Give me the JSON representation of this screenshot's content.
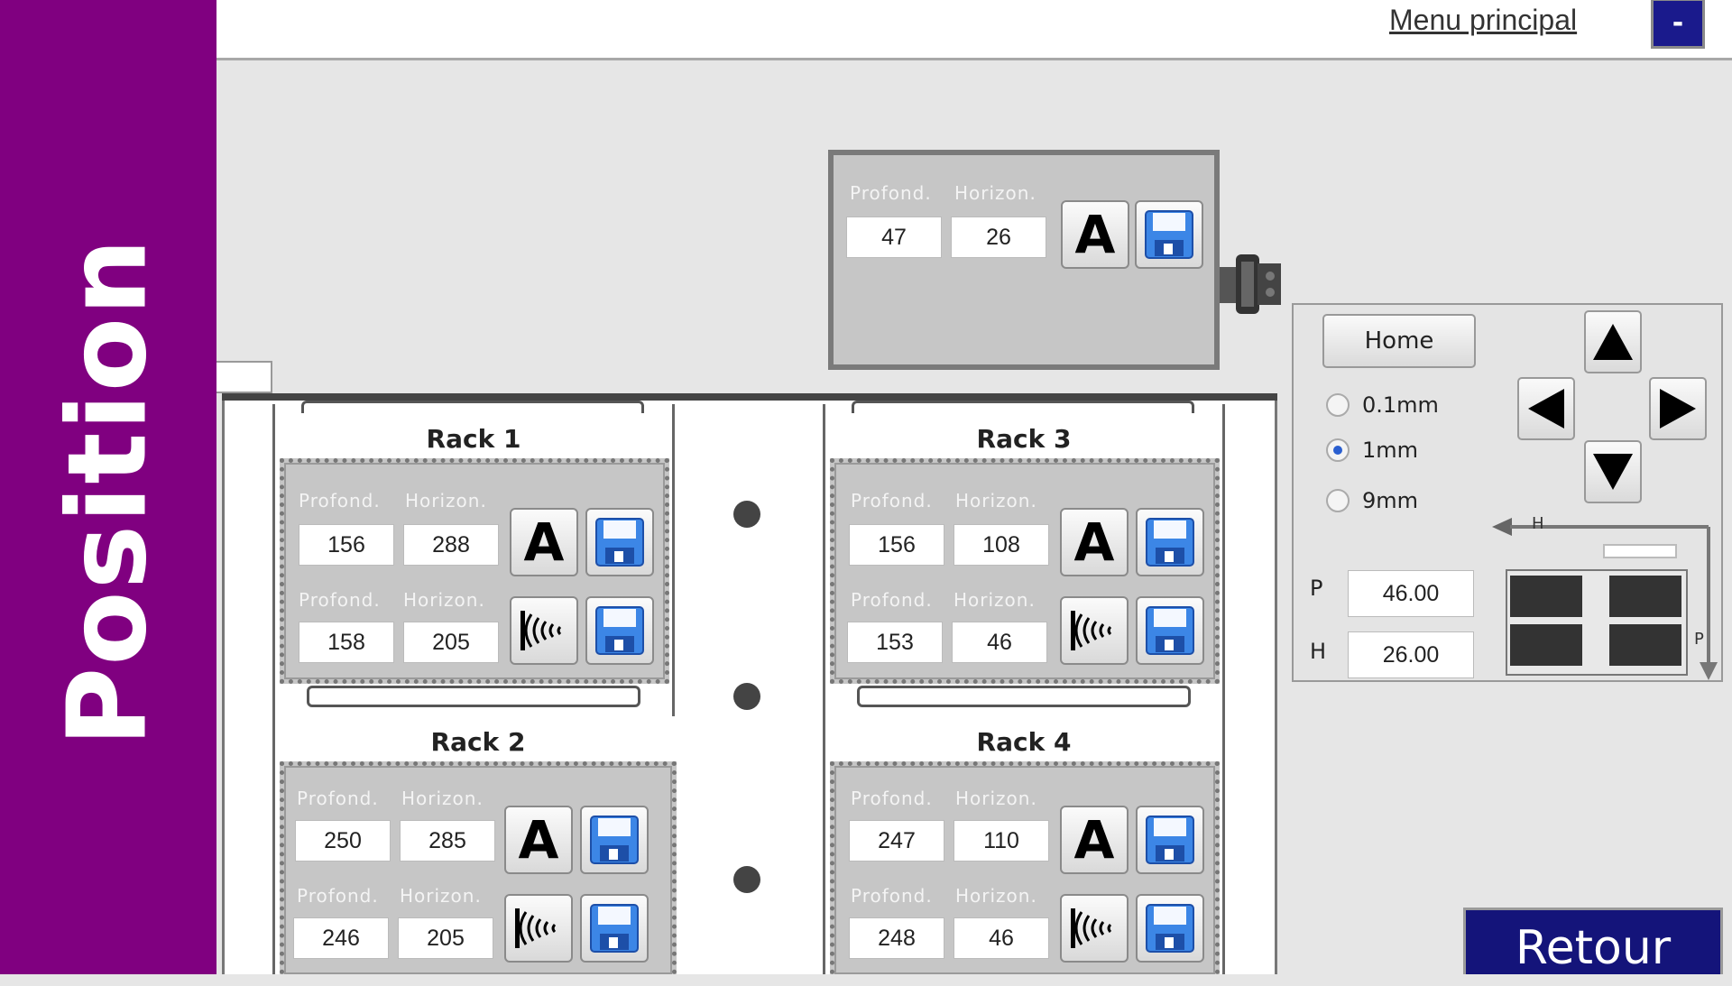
{
  "sidebar": {
    "title": "Position"
  },
  "topbar": {
    "menu_label": "Menu principal",
    "minimize_label": "-"
  },
  "labels": {
    "profond": "Profond.",
    "horizon": "Horizon."
  },
  "top_panel": {
    "profond": "47",
    "horizon": "26"
  },
  "racks": [
    {
      "title": "Rack 1",
      "row1": {
        "profond": "156",
        "horizon": "288"
      },
      "row2": {
        "profond": "158",
        "horizon": "205"
      }
    },
    {
      "title": "Rack 2",
      "row1": {
        "profond": "250",
        "horizon": "285"
      },
      "row2": {
        "profond": "246",
        "horizon": "205"
      }
    },
    {
      "title": "Rack 3",
      "row1": {
        "profond": "156",
        "horizon": "108"
      },
      "row2": {
        "profond": "153",
        "horizon": "46"
      }
    },
    {
      "title": "Rack 4",
      "row1": {
        "profond": "247",
        "horizon": "110"
      },
      "row2": {
        "profond": "248",
        "horizon": "46"
      }
    }
  ],
  "control": {
    "home_label": "Home",
    "steps": [
      {
        "label": "0.1mm",
        "selected": false
      },
      {
        "label": "1mm",
        "selected": true
      },
      {
        "label": "9mm",
        "selected": false
      }
    ],
    "p_label": "P",
    "h_label": "H",
    "p_value": "46.00",
    "h_value": "26.00",
    "diagram_h": "H",
    "diagram_p": "P"
  },
  "retour_label": "Retour",
  "colors": {
    "sidebar": "#800080",
    "button_dark": "#14147a",
    "save_blue": "#3c86e6"
  }
}
